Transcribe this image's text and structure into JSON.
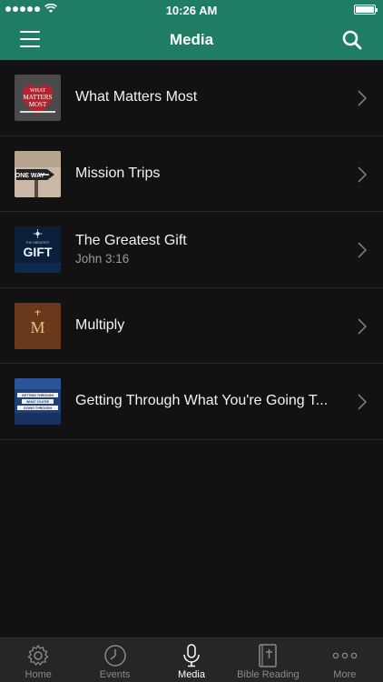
{
  "status_bar": {
    "time": "10:26 AM",
    "signal_dots": 5
  },
  "nav": {
    "title": "Media"
  },
  "colors": {
    "header": "#1f7d66",
    "background": "#121212",
    "tab_bar": "#262626"
  },
  "items": [
    {
      "title": "What Matters Most",
      "subtitle": "",
      "thumb_icon": "what-matters-most-artwork",
      "thumb_text": "WHAT MATTERS MOST"
    },
    {
      "title": "Mission Trips",
      "subtitle": "",
      "thumb_icon": "one-way-sign-artwork",
      "thumb_text": "ONE WAY"
    },
    {
      "title": "The Greatest Gift",
      "subtitle": "John 3:16",
      "thumb_icon": "greatest-gift-artwork",
      "thumb_text": "GIFT"
    },
    {
      "title": "Multiply",
      "subtitle": "",
      "thumb_icon": "multiply-artwork",
      "thumb_text": "M"
    },
    {
      "title": "Getting Through What You're Going T...",
      "subtitle": "",
      "thumb_icon": "getting-through-artwork",
      "thumb_text": "GETTING THROUGH"
    }
  ],
  "tabs": [
    {
      "label": "Home",
      "icon": "gear-icon",
      "active": false
    },
    {
      "label": "Events",
      "icon": "clock-icon",
      "active": false
    },
    {
      "label": "Media",
      "icon": "microphone-icon",
      "active": true
    },
    {
      "label": "Bible Reading",
      "icon": "bible-icon",
      "active": false
    },
    {
      "label": "More",
      "icon": "more-dots-icon",
      "active": false
    }
  ]
}
